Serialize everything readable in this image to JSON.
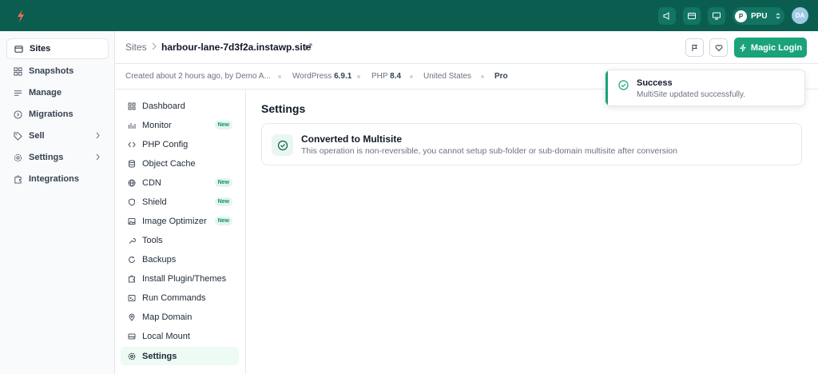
{
  "topbar": {
    "plan_initial": "P",
    "plan_label": "PPU",
    "avatar_initials": "DA",
    "icons": [
      "logo-bolt-icon",
      "megaphone-icon",
      "credit-card-icon",
      "monitor-icon",
      "chevron-updown-icon"
    ]
  },
  "sidebar": {
    "items": [
      {
        "label": "Sites",
        "icon": "window-icon",
        "active": true
      },
      {
        "label": "Snapshots",
        "icon": "grid-icon"
      },
      {
        "label": "Manage",
        "icon": "menu-lines-icon"
      },
      {
        "label": "Migrations",
        "icon": "circle-arrow-icon"
      },
      {
        "label": "Sell",
        "icon": "tag-icon",
        "has_chevron": true
      },
      {
        "label": "Settings",
        "icon": "gear-icon",
        "has_chevron": true
      },
      {
        "label": "Integrations",
        "icon": "puzzle-icon"
      }
    ]
  },
  "header": {
    "breadcrumb_root": "Sites",
    "site_name": "harbour-lane-7d3f2a.instawp.site",
    "magic_login_label": "Magic Login"
  },
  "meta": {
    "created": "Created about 2 hours ago, by Demo A...",
    "wp_label": "WordPress",
    "wp_version": "6.9.1",
    "php_label": "PHP",
    "php_version": "8.4",
    "country": "United States",
    "plan": "Pro"
  },
  "subnav": {
    "new_badge": "New",
    "items": [
      {
        "label": "Dashboard",
        "icon": "grid-icon"
      },
      {
        "label": "Monitor",
        "icon": "bar-chart-icon",
        "badge": true
      },
      {
        "label": "PHP Config",
        "icon": "code-icon"
      },
      {
        "label": "Object Cache",
        "icon": "database-icon"
      },
      {
        "label": "CDN",
        "icon": "globe-icon",
        "badge": true
      },
      {
        "label": "Shield",
        "icon": "shield-icon",
        "badge": true
      },
      {
        "label": "Image Optimizer",
        "icon": "image-icon",
        "badge": true
      },
      {
        "label": "Tools",
        "icon": "wrench-icon"
      },
      {
        "label": "Backups",
        "icon": "refresh-icon"
      },
      {
        "label": "Install Plugin/Themes",
        "icon": "puzzle-icon"
      },
      {
        "label": "Run Commands",
        "icon": "terminal-icon"
      },
      {
        "label": "Map Domain",
        "icon": "map-pin-icon"
      },
      {
        "label": "Local Mount",
        "icon": "hard-drive-icon"
      },
      {
        "label": "Settings",
        "icon": "gear-icon",
        "active": true
      }
    ]
  },
  "content": {
    "title": "Settings",
    "card_title": "Converted to Multisite",
    "card_desc": "This operation is non-reversible, you cannot setup sub-folder or sub-domain multisite after conversion"
  },
  "toast": {
    "title": "Success",
    "message": "MultiSite updated successfully."
  },
  "colors": {
    "topbar": "#0b5e4f",
    "accent": "#1aa37a",
    "badge_bg": "#e3f6ec"
  }
}
